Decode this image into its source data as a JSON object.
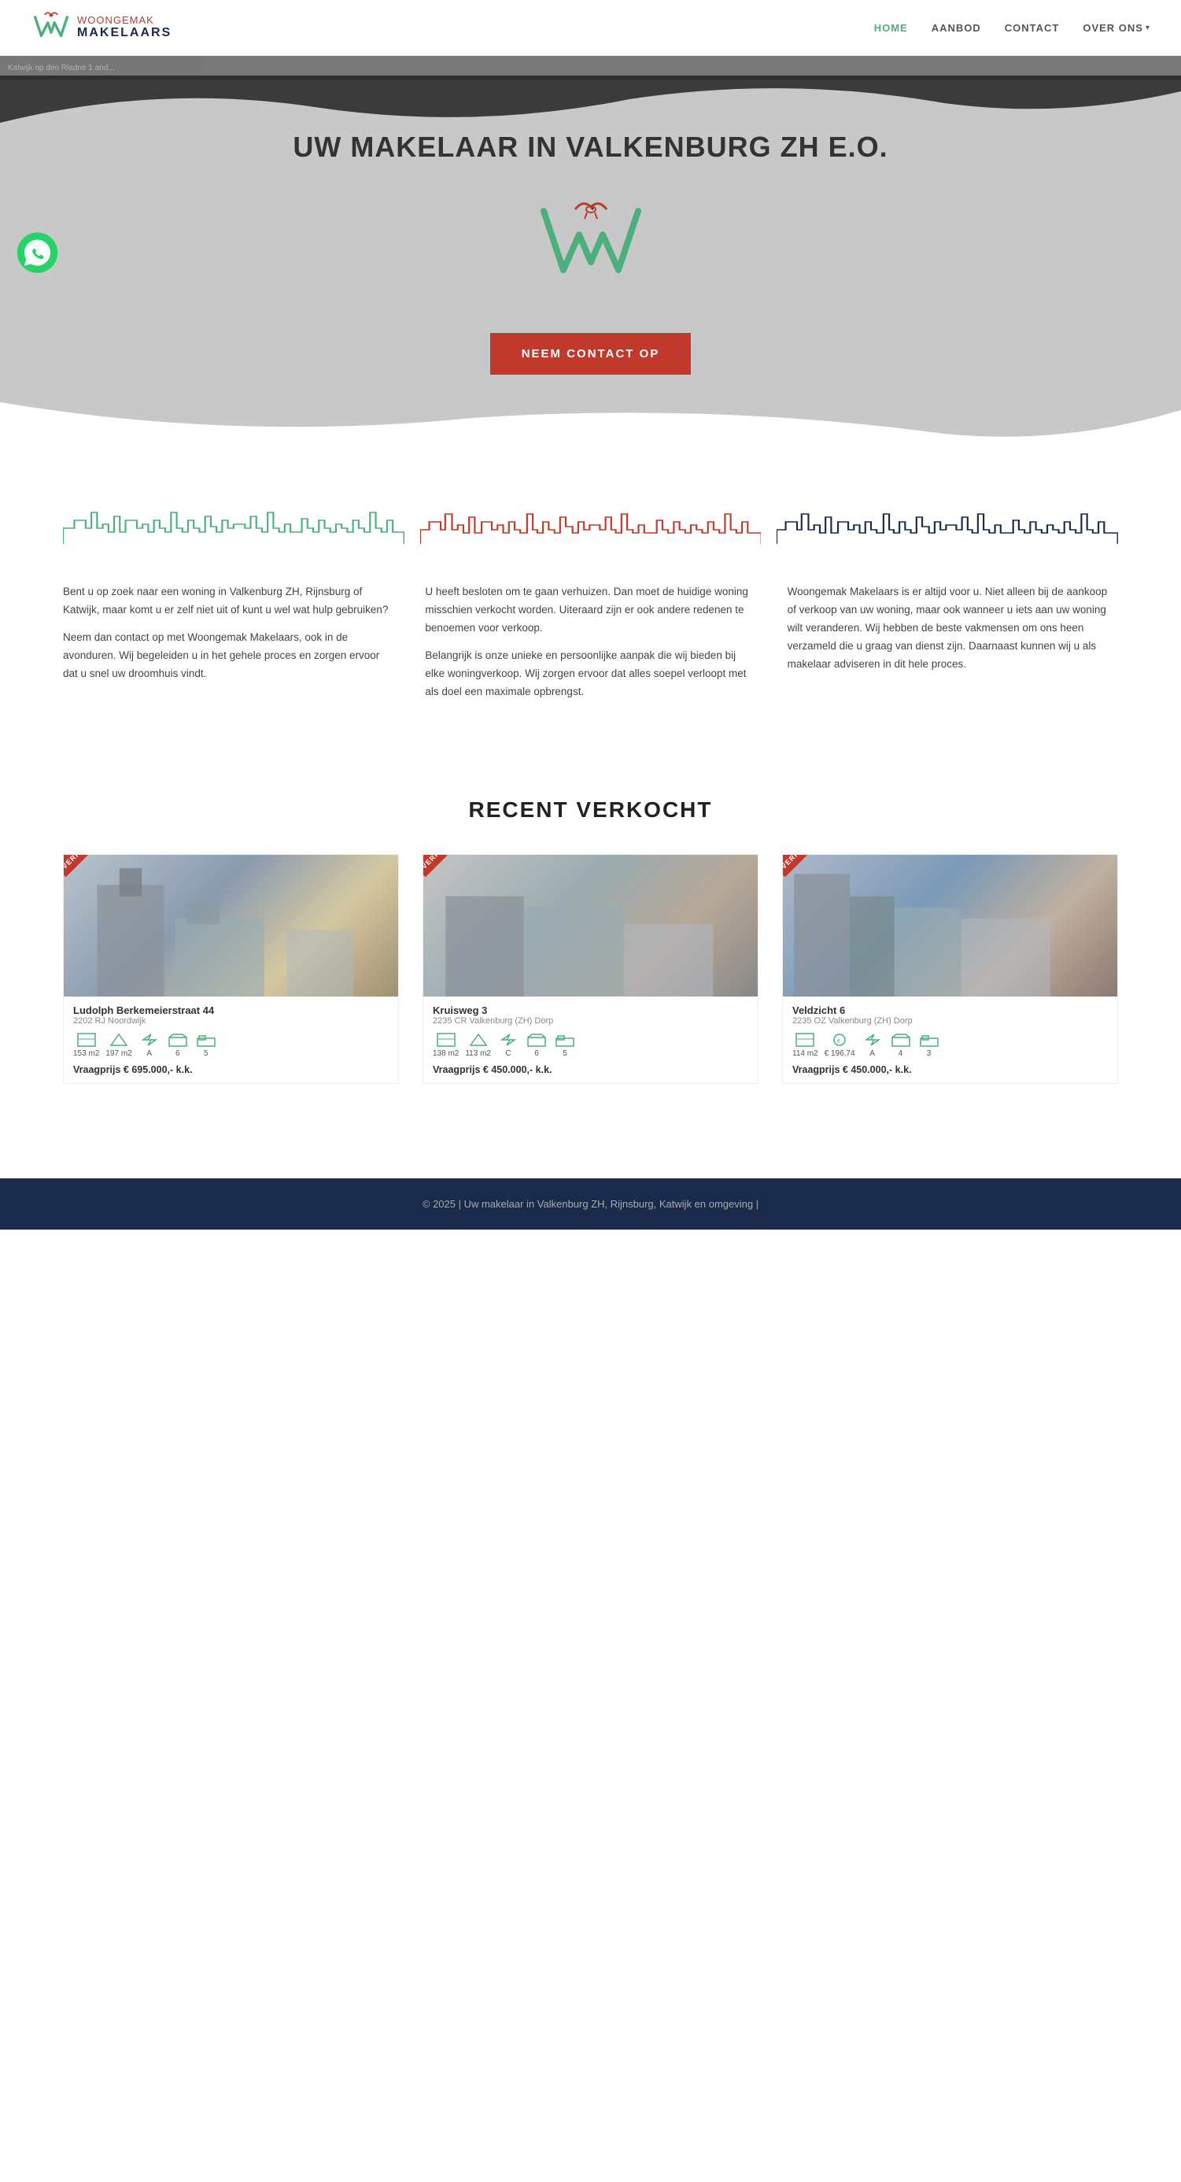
{
  "header": {
    "logo_brand_top": "WOONGEMAK",
    "logo_brand_bottom": "MAKELAARS",
    "nav": {
      "home": "HOME",
      "aanbod": "AANBOD",
      "contact": "CONTACT",
      "over_ons": "OVER ONS"
    }
  },
  "hero": {
    "map_text": "Katwijk op den Rladne 1 and...",
    "title": "UW MAKELAAR IN VALKENBURG ZH E.O.",
    "cta_button": "NEEM CONTACT OP"
  },
  "info_section": {
    "col1": {
      "p1": "Bent u op zoek naar een woning in Valkenburg ZH, Rijnsburg of Katwijk, maar komt u er zelf niet uit of kunt u wel wat hulp gebruiken?",
      "p2": "Neem dan contact op met Woongemak Makelaars, ook in de avonduren. Wij begeleiden u in het gehele proces en zorgen ervoor dat u snel uw droomhuis vindt."
    },
    "col2": {
      "p1": "U heeft besloten om te gaan verhuizen. Dan moet de huidige woning misschien verkocht worden. Uiteraard zijn er ook andere redenen te benoemen voor verkoop.",
      "p2": "Belangrijk is onze unieke en persoonlijke aanpak die wij bieden bij elke woningverkoop. Wij zorgen ervoor dat alles soepel verloopt met als doel een maximale opbrengst."
    },
    "col3": {
      "p1": "Woongemak Makelaars is er altijd voor u. Niet alleen bij de aankoop of verkoop van uw woning, maar ook wanneer u iets aan uw woning wilt veranderen. Wij hebben de beste vakmensen om ons heen verzameld die u graag van dienst zijn. Daarnaast kunnen wij u als makelaar adviseren in dit hele proces."
    }
  },
  "recent_section": {
    "title": "RECENT VERKOCHT",
    "properties": [
      {
        "badge": "VERKOCHT",
        "address": "Ludolph Berkemeierstraat 44",
        "city": "2202 RJ Noordwijk",
        "specs": [
          {
            "label": "153 m2"
          },
          {
            "label": "197 m2"
          },
          {
            "label": "A"
          },
          {
            "label": "6"
          },
          {
            "label": "5"
          }
        ],
        "price": "Vraagprijs € 695.000,- k.k."
      },
      {
        "badge": "VERKOCHT",
        "address": "Kruisweg 3",
        "city": "2235 CR Valkenburg (ZH) Dorp",
        "specs": [
          {
            "label": "138 m2"
          },
          {
            "label": "113 m2"
          },
          {
            "label": "C"
          },
          {
            "label": "6"
          },
          {
            "label": "5"
          }
        ],
        "price": "Vraagprijs € 450.000,- k.k."
      },
      {
        "badge": "VERKOCHT",
        "address": "Veldzicht 6",
        "city": "2235 OZ Valkenburg (ZH) Dorp",
        "specs": [
          {
            "label": "114 m2"
          },
          {
            "label": "€ 196,74"
          },
          {
            "label": "A"
          },
          {
            "label": "4"
          },
          {
            "label": "3"
          }
        ],
        "price": "Vraagprijs € 450.000,- k.k."
      }
    ]
  },
  "footer": {
    "text": "© 2025 | Uw makelaar in Valkenburg ZH, Rijnsburg, Katwijk en omgeving |"
  }
}
